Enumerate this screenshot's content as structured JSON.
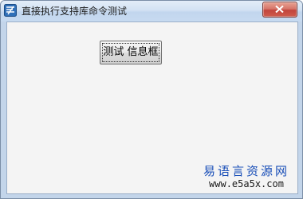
{
  "window": {
    "title": "直接执行支持库命令测试",
    "icon": "app-icon",
    "close_icon": "close-icon"
  },
  "main": {
    "test_button_label": "测试 信息框"
  },
  "watermark": {
    "line1": "易语言资源网",
    "line2": "www.e5a5x.com"
  },
  "colors": {
    "title_bar": "#c7daf0",
    "close_button": "#c2443c",
    "client_background": "#f4f4f4",
    "watermark_text": "#1a4fb8"
  }
}
